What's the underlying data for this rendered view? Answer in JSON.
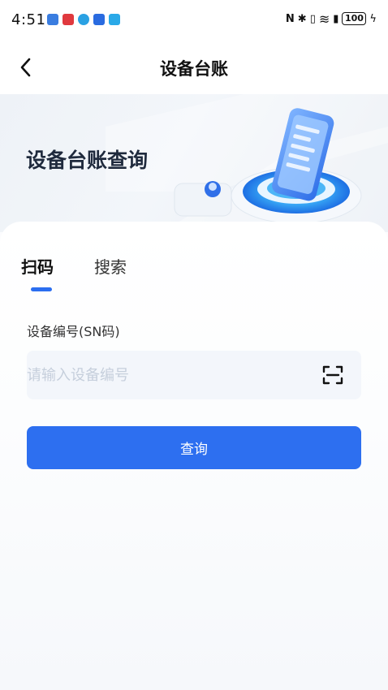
{
  "status_bar": {
    "time": "4:51",
    "notification_colors": [
      "#3a7de0",
      "#e0393e",
      "#2aa1e3",
      "#2a6be0",
      "#2aa9e8"
    ],
    "nfc": "N",
    "bluetooth": "✱",
    "vibrate": "▯",
    "wifi": "≋",
    "sim": "▮",
    "battery": "100",
    "charging": "ϟ"
  },
  "nav": {
    "title": "设备台账",
    "back_icon": "chevron-left-icon"
  },
  "banner": {
    "title": "设备台账查询"
  },
  "tabs": {
    "scan_label": "扫码",
    "search_label": "搜索",
    "active": "扫码"
  },
  "form": {
    "field_label": "设备编号(SN码)",
    "placeholder": "请输入设备编号",
    "value": "",
    "scan_icon": "scan-icon",
    "submit_label": "查询"
  },
  "colors": {
    "primary": "#2d6ff0",
    "input_bg": "#f3f6fb",
    "placeholder": "#c6cfdc"
  }
}
